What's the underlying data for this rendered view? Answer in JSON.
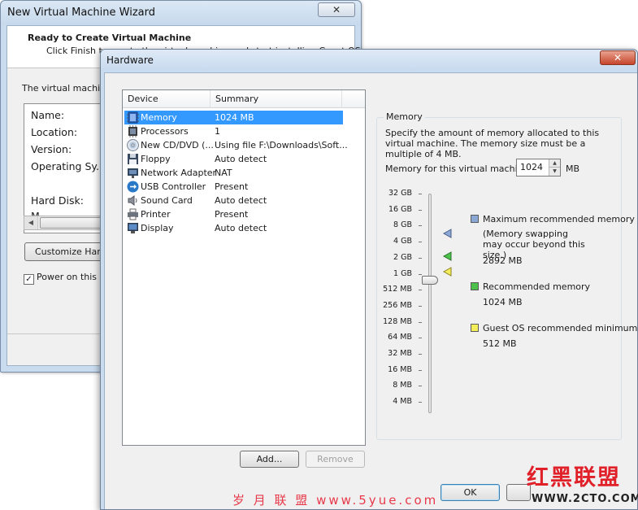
{
  "wizard": {
    "title": "New Virtual Machine Wizard",
    "close": "✕",
    "heading": "Ready to Create Virtual Machine",
    "subheading": "Click Finish to create the virtual machine and start installing Guest OS",
    "body_text": "The virtual machine",
    "summary_rows": [
      "Name:",
      "Location:",
      "Version:",
      "Operating Sy...",
      "Hard Disk:",
      "M..."
    ],
    "customize_label": "Customize Hardw",
    "power_on_label": "Power on this vi",
    "power_on_checked": "✓"
  },
  "hardware": {
    "title": "Hardware",
    "close": "✕",
    "columns": {
      "device": "Device",
      "summary": "Summary"
    },
    "devices": [
      {
        "name": "Memory",
        "summary": "1024 MB",
        "icon": "memory-icon"
      },
      {
        "name": "Processors",
        "summary": "1",
        "icon": "processor-icon"
      },
      {
        "name": "New CD/DVD (...",
        "summary": "Using file F:\\Downloads\\Soft...",
        "icon": "cd-dvd-icon"
      },
      {
        "name": "Floppy",
        "summary": "Auto detect",
        "icon": "floppy-icon"
      },
      {
        "name": "Network Adapter",
        "summary": "NAT",
        "icon": "network-adapter-icon"
      },
      {
        "name": "USB Controller",
        "summary": "Present",
        "icon": "usb-icon"
      },
      {
        "name": "Sound Card",
        "summary": "Auto detect",
        "icon": "speaker-icon"
      },
      {
        "name": "Printer",
        "summary": "Present",
        "icon": "printer-icon"
      },
      {
        "name": "Display",
        "summary": "Auto detect",
        "icon": "monitor-icon"
      }
    ],
    "add_label": "Add...",
    "remove_label": "Remove",
    "ok_label": "OK"
  },
  "memory": {
    "group_label": "Memory",
    "description": "Specify the amount of memory allocated to this virtual machine. The memory size must be a multiple of 4 MB.",
    "for_vm_label": "Memory for this virtual machine:",
    "value": "1024",
    "unit": "MB",
    "scale": [
      "32 GB",
      "16 GB",
      "8 GB",
      "4 GB",
      "2 GB",
      "1 GB",
      "512 MB",
      "256 MB",
      "128 MB",
      "64 MB",
      "32 MB",
      "16 MB",
      "8 MB",
      "4 MB"
    ],
    "legend": {
      "max_label": "Maximum recommended memory",
      "max_note": "(Memory swapping may occur beyond this size.)",
      "max_value": "2892 MB",
      "rec_label": "Recommended memory",
      "rec_value": "1024 MB",
      "min_label": "Guest OS recommended minimum",
      "min_value": "512 MB"
    },
    "colors": {
      "max": "#8aa7d6",
      "rec": "#4cc24c",
      "min": "#f3ee5a"
    }
  },
  "watermarks": {
    "logo_cn": "红黑联盟",
    "logo_url": "WWW.2CTO.COM",
    "mid": "岁 月 联 盟  www.5yue.com"
  }
}
